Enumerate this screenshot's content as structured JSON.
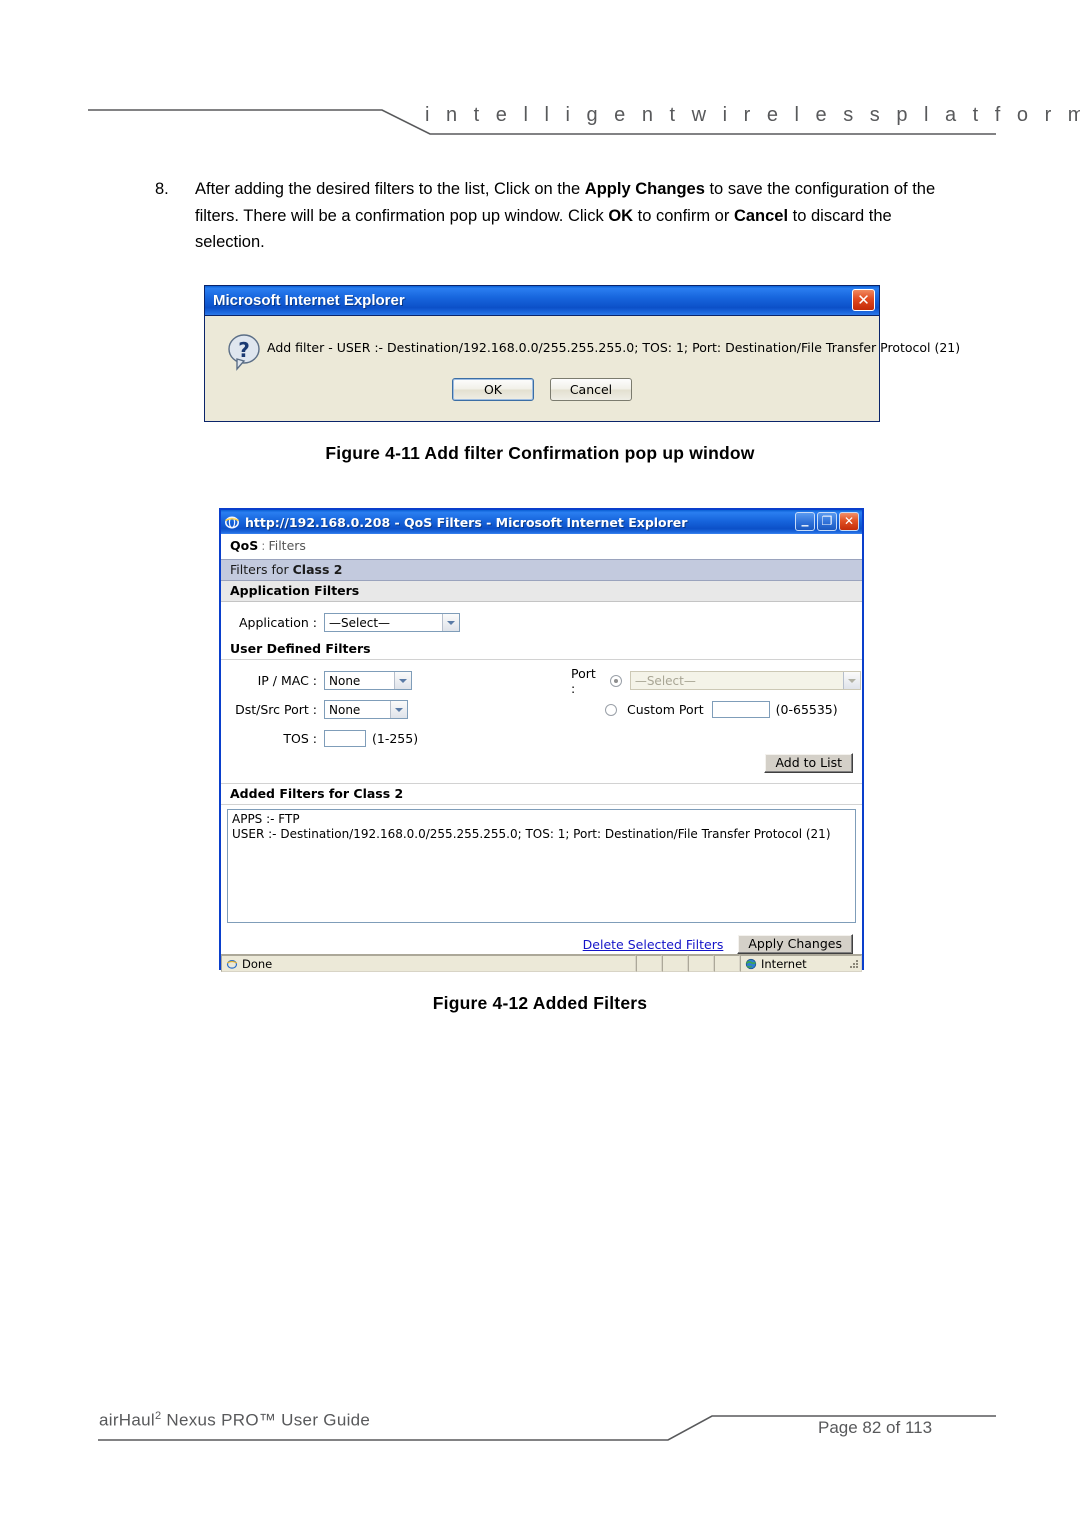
{
  "header": {
    "tagline": "i n t e l l i g e n t      w i r e l e s s      p l a t f o r m"
  },
  "step": {
    "number": "8.",
    "text_part1": "After adding the desired filters to the list, Click on the ",
    "bold1": "Apply Changes",
    "text_part2": " to save the configuration of the filters. There will be a confirmation pop up window. Click ",
    "bold2": "OK",
    "text_part3": " to confirm or ",
    "bold3": "Cancel",
    "text_part4": " to discard the selection."
  },
  "dialog": {
    "title": "Microsoft Internet Explorer",
    "icon": "question-mark-icon",
    "message": "Add filter - USER :- Destination/192.168.0.0/255.255.255.0; TOS: 1; Port: Destination/File Transfer Protocol (21)",
    "ok_label": "OK",
    "cancel_label": "Cancel",
    "close_glyph": "✕"
  },
  "figure_4_11": {
    "caption": "Figure 4-11 Add filter Confirmation pop up window"
  },
  "browser": {
    "title": "http://192.168.0.208 - QoS Filters - Microsoft Internet Explorer",
    "controls": {
      "minimize": "_",
      "maximize": "❐",
      "close": "✕"
    },
    "breadcrumb": {
      "main": "QoS",
      "separator": ":",
      "sub": "Filters"
    },
    "class_bar": {
      "prefix": "Filters for ",
      "value": "Class 2"
    },
    "application_filters": {
      "section_title": "Application Filters",
      "application_label": "Application :",
      "application_value": "—Select—"
    },
    "user_defined_filters": {
      "section_title": "User Defined Filters",
      "ipmac_label": "IP / MAC :",
      "ipmac_value": "None",
      "dstsrc_label": "Dst/Src Port :",
      "dstsrc_value": "None",
      "tos_label": "TOS :",
      "tos_value": "",
      "tos_hint": "(1-255)",
      "port_label": "Port :",
      "port_select_value": "—Select—",
      "custom_port_label": "Custom Port",
      "custom_port_value": "",
      "custom_port_hint": "(0-65535)",
      "add_to_list_label": "Add to List"
    },
    "added_filters": {
      "section_title": "Added Filters for Class 2",
      "rows": [
        "APPS :- FTP",
        "USER :- Destination/192.168.0.0/255.255.255.0; TOS: 1; Port: Destination/File Transfer Protocol (21)"
      ]
    },
    "actions": {
      "delete_label": "Delete Selected Filters",
      "apply_label": "Apply Changes"
    },
    "statusbar": {
      "status_text": "Done",
      "zone_text": "Internet"
    }
  },
  "figure_4_12": {
    "caption": "Figure 4-12 Added Filters"
  },
  "footer": {
    "left_pre": "airHaul",
    "left_sup": "2",
    "left_post": " Nexus PRO™ User Guide",
    "right": "Page 82 of 113"
  },
  "colors": {
    "titlebar_blue": "#1765dd",
    "dialog_face": "#ece9d8",
    "section_blue": "#c3cade",
    "link_blue": "#1414c8",
    "footer_grey": "#58595b"
  }
}
